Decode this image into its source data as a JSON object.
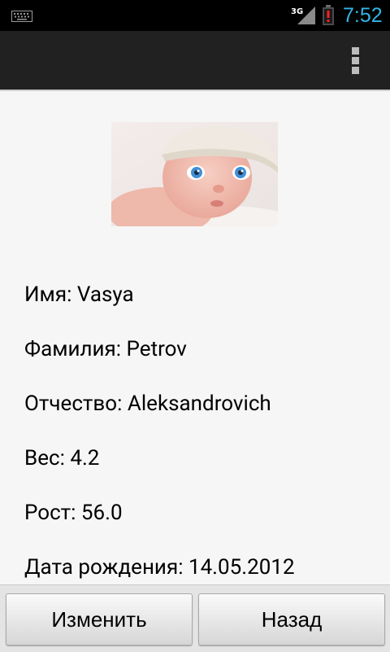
{
  "status_bar": {
    "time": "7:52",
    "network": "3G",
    "accent_color": "#33b5e5",
    "icons": [
      "keyboard-icon",
      "signal-icon",
      "battery-alert-icon"
    ]
  },
  "action_bar": {
    "overflow_icon": "overflow-menu-icon"
  },
  "profile": {
    "photo": "baby-photo",
    "first_name_line": "Имя: Vasya",
    "last_name_line": "Фамилия: Petrov",
    "patronymic_line": "Отчество: Aleksandrovich",
    "weight_line": "Вес: 4.2",
    "height_line": "Рост: 56.0",
    "birthdate_line": "Дата рождения: 14.05.2012"
  },
  "buttons": {
    "edit_label": "Изменить",
    "back_label": "Назад"
  }
}
